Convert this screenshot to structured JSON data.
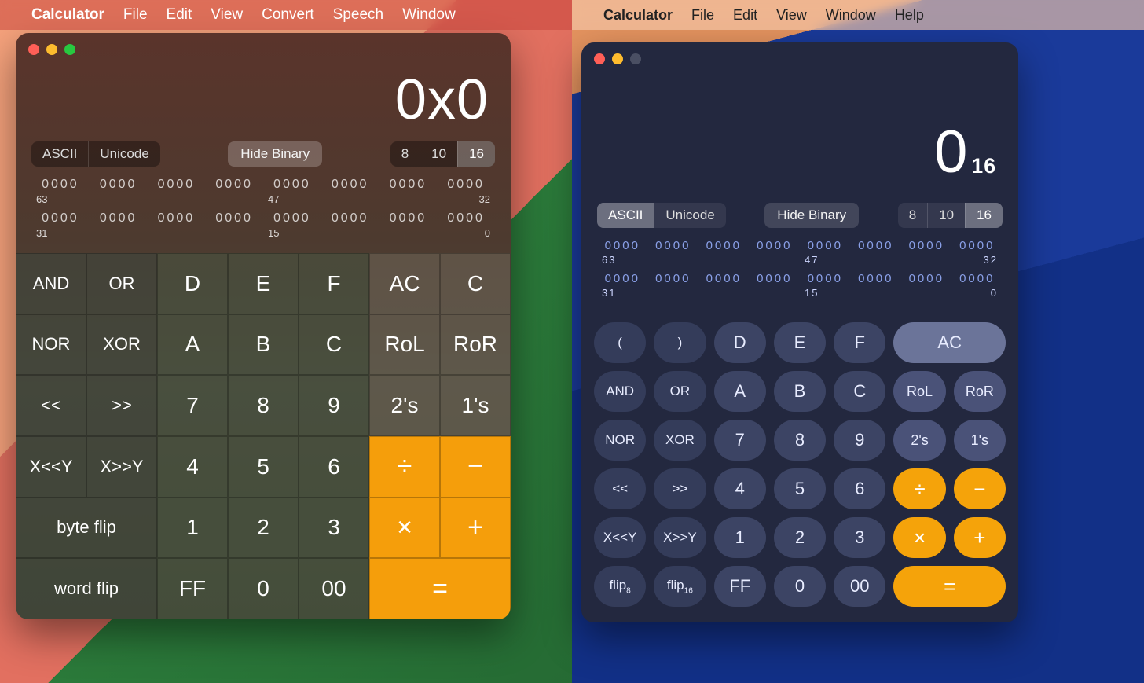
{
  "menus": {
    "left": {
      "app": "Calculator",
      "items": [
        "File",
        "Edit",
        "View",
        "Convert",
        "Speech",
        "Window"
      ]
    },
    "right": {
      "app": "Calculator",
      "items": [
        "File",
        "Edit",
        "View",
        "Window",
        "Help"
      ]
    }
  },
  "left": {
    "display": "0x0",
    "encoding": {
      "ascii": "ASCII",
      "unicode": "Unicode",
      "selected": "ASCII"
    },
    "hideBinary": "Hide Binary",
    "base": {
      "options": [
        "8",
        "10",
        "16"
      ],
      "selected": "16"
    },
    "binary": {
      "row1": [
        "0000",
        "0000",
        "0000",
        "0000",
        "0000",
        "0000",
        "0000",
        "0000"
      ],
      "idx1": [
        "63",
        "47",
        "32"
      ],
      "row2": [
        "0000",
        "0000",
        "0000",
        "0000",
        "0000",
        "0000",
        "0000",
        "0000"
      ],
      "idx2": [
        "31",
        "15",
        "0"
      ]
    },
    "rows": [
      [
        "AND",
        "OR",
        "D",
        "E",
        "F",
        "AC",
        "C"
      ],
      [
        "NOR",
        "XOR",
        "A",
        "B",
        "C",
        "RoL",
        "RoR"
      ],
      [
        "<<",
        ">>",
        "7",
        "8",
        "9",
        "2's",
        "1's"
      ],
      [
        "X<<Y",
        "X>>Y",
        "4",
        "5",
        "6",
        "÷",
        "−"
      ],
      [
        "byte flip",
        "",
        "1",
        "2",
        "3",
        "×",
        "+"
      ],
      [
        "word flip",
        "",
        "FF",
        "0",
        "00",
        "=",
        ""
      ]
    ]
  },
  "right": {
    "displayMain": "0",
    "displaySub": "16",
    "encoding": {
      "ascii": "ASCII",
      "unicode": "Unicode",
      "selected": "ASCII"
    },
    "hideBinary": "Hide Binary",
    "base": {
      "options": [
        "8",
        "10",
        "16"
      ],
      "selected": "16"
    },
    "binary": {
      "row1": [
        "0000",
        "0000",
        "0000",
        "0000",
        "0000",
        "0000",
        "0000",
        "0000"
      ],
      "idx1": [
        "63",
        "47",
        "32"
      ],
      "row2": [
        "0000",
        "0000",
        "0000",
        "0000",
        "0000",
        "0000",
        "0000",
        "0000"
      ],
      "idx2": [
        "31",
        "15",
        "0"
      ]
    },
    "keys": {
      "r1": [
        "(",
        "",
        ")",
        "D",
        "E",
        "F",
        "AC"
      ],
      "r2": [
        "AND",
        "OR",
        "A",
        "B",
        "C",
        "RoL",
        "RoR"
      ],
      "r3": [
        "NOR",
        "XOR",
        "7",
        "8",
        "9",
        "2's",
        "1's"
      ],
      "r4": [
        "<<",
        ">>",
        "4",
        "5",
        "6",
        "÷",
        "−"
      ],
      "r5": [
        "X<<Y",
        "X>>Y",
        "1",
        "2",
        "3",
        "×",
        "+"
      ],
      "r6flip8": "flip",
      "r6flip8sub": "8",
      "r6flip16": "flip",
      "r6flip16sub": "16",
      "r6rest": [
        "FF",
        "0",
        "00",
        "="
      ]
    }
  }
}
